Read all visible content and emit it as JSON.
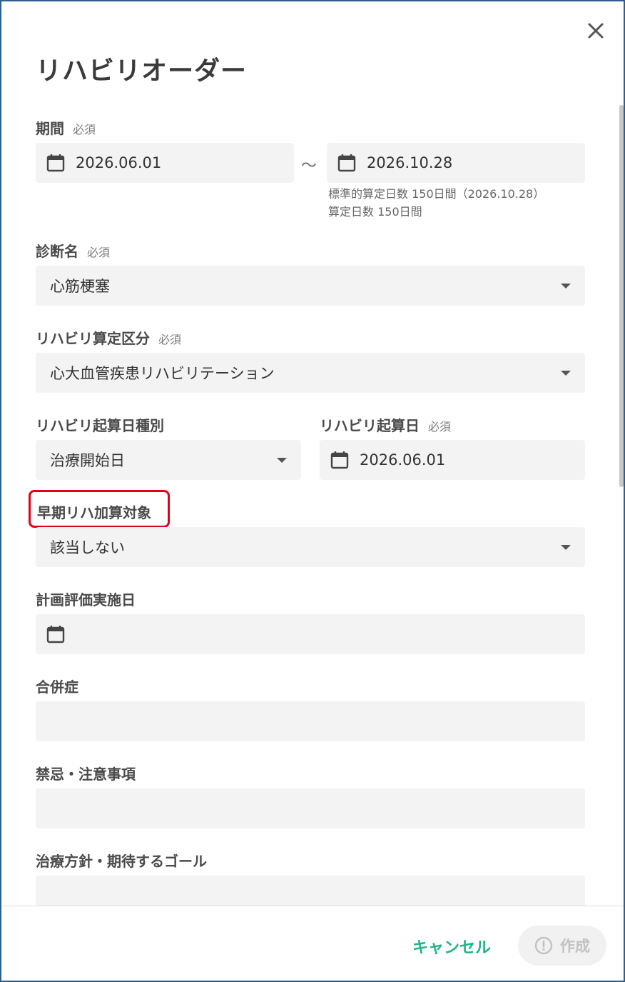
{
  "dialog": {
    "title": "リハビリオーダー",
    "close_icon": "close-icon"
  },
  "period": {
    "label": "期間",
    "required": "必須",
    "start": "2026.06.01",
    "separator": "～",
    "end": "2026.10.28",
    "note_line1": "標準的算定日数 150日間（2026.10.28）",
    "note_line2": "算定日数 150日間"
  },
  "diagnosis": {
    "label": "診断名",
    "required": "必須",
    "value": "心筋梗塞"
  },
  "rehab_category": {
    "label": "リハビリ算定区分",
    "required": "必須",
    "value": "心大血管疾患リハビリテーション"
  },
  "start_type": {
    "label": "リハビリ起算日種別",
    "value": "治療開始日"
  },
  "start_date": {
    "label": "リハビリ起算日",
    "required": "必須",
    "value": "2026.06.01"
  },
  "early_rehab": {
    "label": "早期リハ加算対象",
    "value": "該当しない"
  },
  "plan_eval_date": {
    "label": "計画評価実施日",
    "value": ""
  },
  "complications": {
    "label": "合併症",
    "value": ""
  },
  "contraindications": {
    "label": "禁忌・注意事項",
    "value": ""
  },
  "treatment_policy": {
    "label": "治療方針・期待するゴール",
    "value": ""
  },
  "footer": {
    "cancel_label": "キャンセル",
    "create_label": "作成"
  },
  "colors": {
    "accent": "#1fb48a",
    "highlight": "#e0001a",
    "field_bg": "#f3f3f3",
    "border": "#2f5f8a"
  }
}
